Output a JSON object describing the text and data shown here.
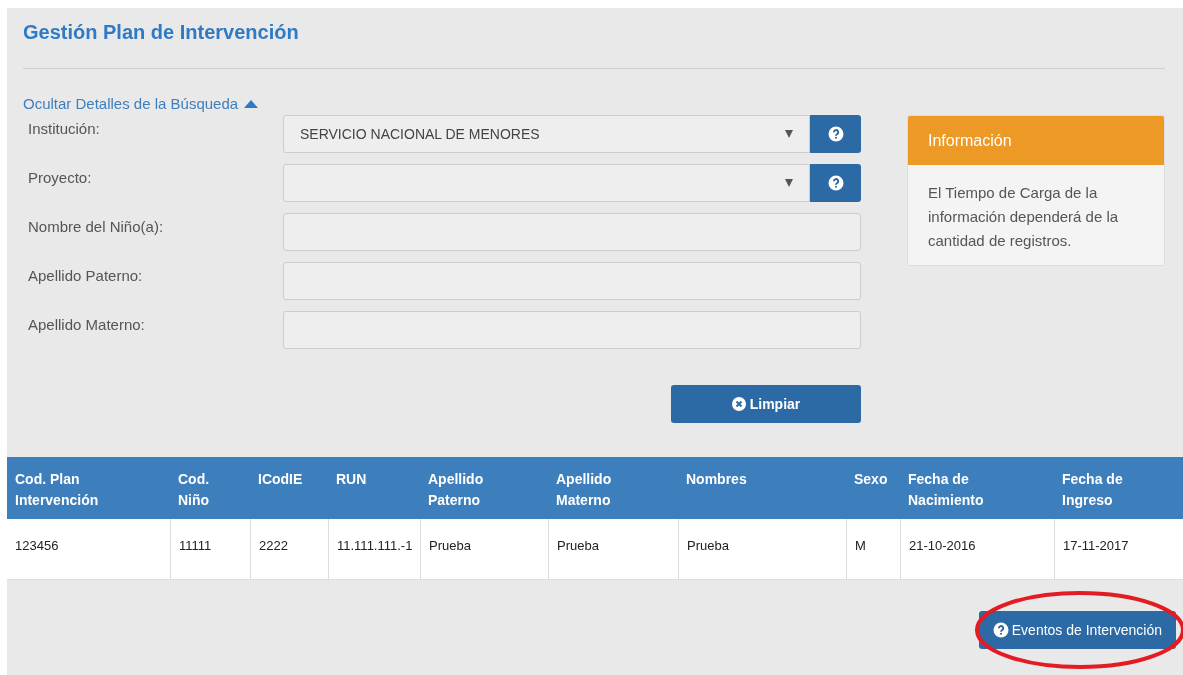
{
  "title": "Gestión Plan de Intervención",
  "search_toggle": {
    "label": "Ocultar Detalles de la Búsqueda",
    "expanded": true
  },
  "fields": [
    {
      "kind": "select",
      "label": "Institución:",
      "value": "SERVICIO NACIONAL DE MENORES"
    },
    {
      "kind": "select",
      "label": "Proyecto:"
    },
    {
      "kind": "text",
      "label": "Nombre del Niño(a):"
    },
    {
      "kind": "text",
      "label": "Apellido Paterno:"
    },
    {
      "kind": "text",
      "label": "Apellido Materno:"
    }
  ],
  "info_panel": {
    "title": "Información",
    "body": "El Tiempo de Carga de la información dependerá de la cantidad de registros."
  },
  "clear_button": "Limpiar",
  "table": {
    "columns": [
      "Cod. Plan Intervención",
      "Cod. Niño",
      "ICodIE",
      "RUN",
      "Apellido Paterno",
      "Apellido Materno",
      "Nombres",
      "Sexo",
      "Fecha de Nacimiento",
      "Fecha de Ingreso"
    ],
    "rows": [
      [
        "123456",
        "11111",
        "2222",
        "11.111.111.-1",
        "Prueba",
        "Prueba",
        "Prueba",
        "M",
        "21-10-2016",
        "17-11-2017"
      ]
    ]
  },
  "events_button": {
    "label": "Eventos de Intervención",
    "highlighted": true
  }
}
